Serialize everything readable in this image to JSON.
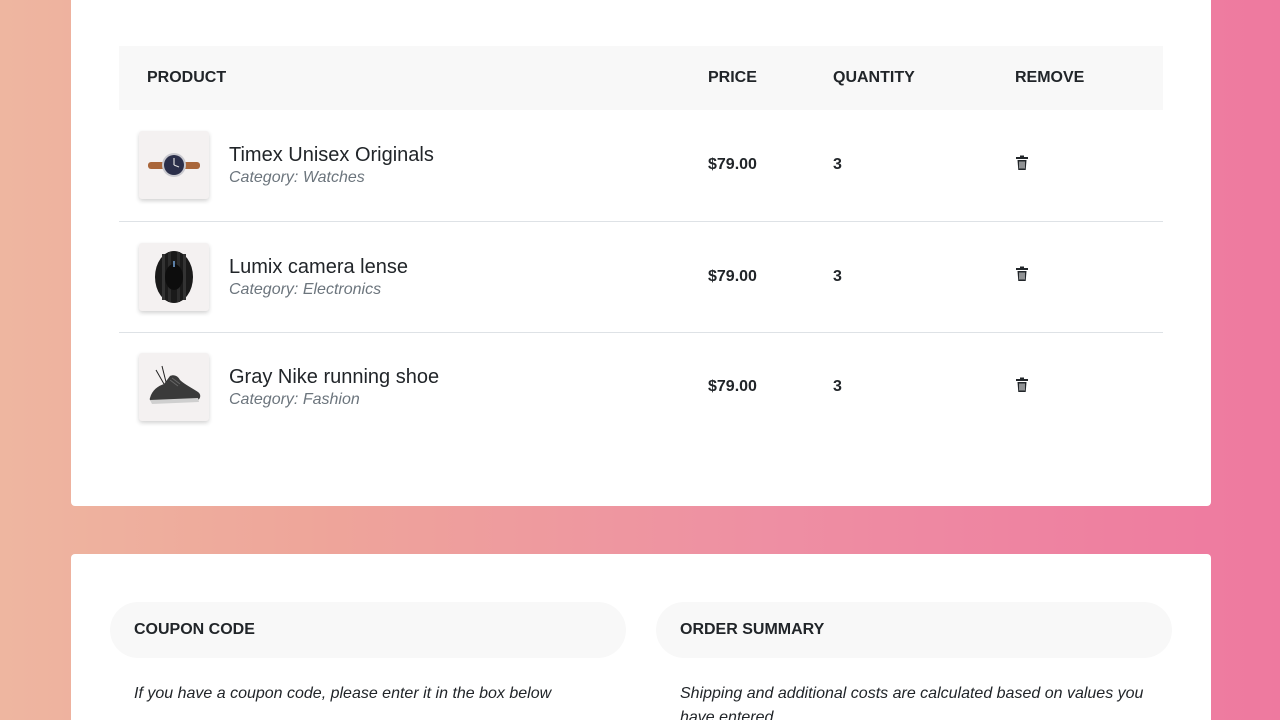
{
  "cart": {
    "headers": {
      "product": "PRODUCT",
      "price": "PRICE",
      "quantity": "QUANTITY",
      "remove": "REMOVE"
    },
    "items": [
      {
        "name": "Timex Unisex Originals",
        "category_prefix": "Category:",
        "category": "Watches",
        "price": "$79.00",
        "quantity": "3",
        "image_icon": "watch-image",
        "remove_icon": "trash-icon"
      },
      {
        "name": "Lumix camera lense",
        "category_prefix": "Category:",
        "category": "Electronics",
        "price": "$79.00",
        "quantity": "3",
        "image_icon": "camera-lens-image",
        "remove_icon": "trash-icon"
      },
      {
        "name": "Gray Nike running shoe",
        "category_prefix": "Category:",
        "category": "Fashion",
        "price": "$79.00",
        "quantity": "3",
        "image_icon": "shoe-image",
        "remove_icon": "trash-icon"
      }
    ]
  },
  "coupon": {
    "title": "COUPON CODE",
    "text": "If you have a coupon code, please enter it in the box below"
  },
  "summary": {
    "title": "ORDER SUMMARY",
    "text": "Shipping and additional costs are calculated based on values you have entered."
  },
  "colors": {
    "gradient_start": "#eeb6a0",
    "gradient_end": "#ee799f",
    "header_bg": "#f8f8f8",
    "text_dark": "#212529",
    "text_muted": "#6c757d"
  }
}
